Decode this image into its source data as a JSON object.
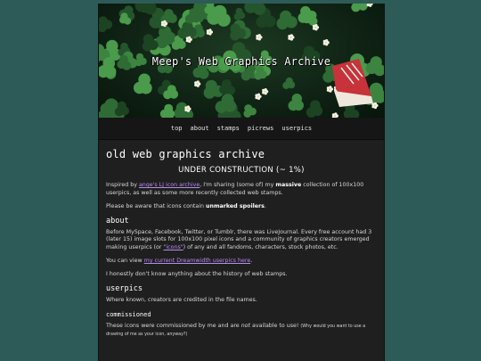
{
  "site": {
    "title": "Meep's Web Graphics Archive",
    "nav": [
      "top",
      "about",
      "stamps",
      "picrews",
      "userpics"
    ]
  },
  "main": {
    "heading": "old web graphics archive",
    "status": "UNDER CONSTRUCTION (~ 1%)",
    "intro": {
      "pre": "Inspired by ",
      "link": "ange's LJ icon archive",
      "mid": ", I'm sharing (some of) my ",
      "bold": "massive",
      "post": " collection of 100x100 userpics, as well as some more recently collected web stamps."
    },
    "warning": {
      "pre": "Please be aware that icons contain ",
      "bold": "unmarked spoilers",
      "post": "."
    }
  },
  "about": {
    "heading": "about",
    "p1_pre": "Before MySpace, Facebook, Twitter, or Tumblr, there was LiveJournal. Every free account had 3 (later 15) image slots for 100x100 pixel icons and a community of graphics creators emerged making userpics (or ",
    "p1_link": "\"icons\"",
    "p1_post": ") of any and all fandoms, characters, stock photos, etc.",
    "p2_pre": "You can view ",
    "p2_link": "my current Dreamwidth userpics here",
    "p2_post": ".",
    "p3": "I honestly don't know anything about the history of web stamps."
  },
  "userpics": {
    "heading": "userpics",
    "p1": "Where known, creators are credited in the file names.",
    "sub_heading": "commissioned",
    "p2_pre": "These icons were commissioned by me and are ",
    "p2_em": "not",
    "p2_mid": " available to use! ",
    "p2_small": "(Why would you want to use a drawing of me as your icon, anyway?)"
  },
  "colors": {
    "page_background": "#2d5b57",
    "content_background": "#1f1f1f",
    "link": "#b78cf1"
  }
}
